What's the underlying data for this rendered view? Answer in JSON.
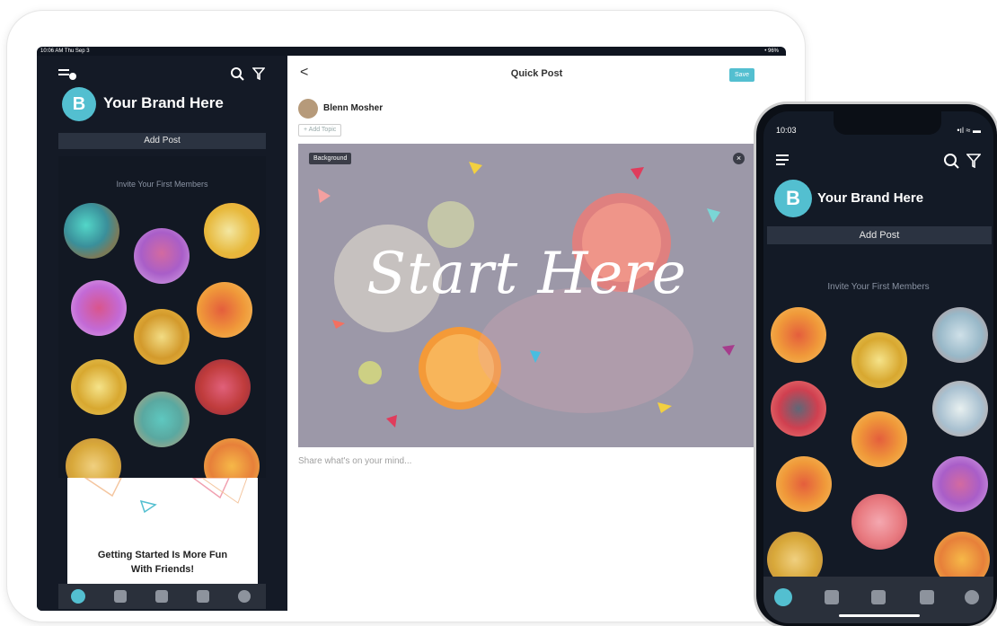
{
  "tablet": {
    "status_left": "10:06 AM  Thu Sep 3",
    "status_right": "• 96%",
    "sidebar": {
      "logo_letter": "B",
      "brand": "Your Brand Here",
      "add_post": "Add Post",
      "invite": "Invite Your First Members",
      "card_text_line1": "Getting Started Is More Fun",
      "card_text_line2": "With Friends!"
    },
    "main": {
      "back": "<",
      "title": "Quick Post",
      "save": "Save",
      "user_name": "Blenn Mosher",
      "add_topic": "+ Add Topic",
      "background_label": "Background",
      "close": "×",
      "image_text": "Start Here",
      "placeholder": "Share what's on your mind..."
    }
  },
  "phone": {
    "time": "10:03",
    "signal": "•ıl ≈ ▬",
    "logo_letter": "B",
    "brand": "Your Brand Here",
    "add_post": "Add Post",
    "invite": "Invite Your First Members"
  },
  "colors": {
    "accent": "#53bfd0",
    "dark_bg": "#141a26"
  },
  "icons": [
    "menu-icon",
    "search-icon",
    "filter-icon",
    "back-icon",
    "close-icon",
    "home-icon",
    "chat-icon",
    "add-icon",
    "notification-icon",
    "profile-icon"
  ]
}
